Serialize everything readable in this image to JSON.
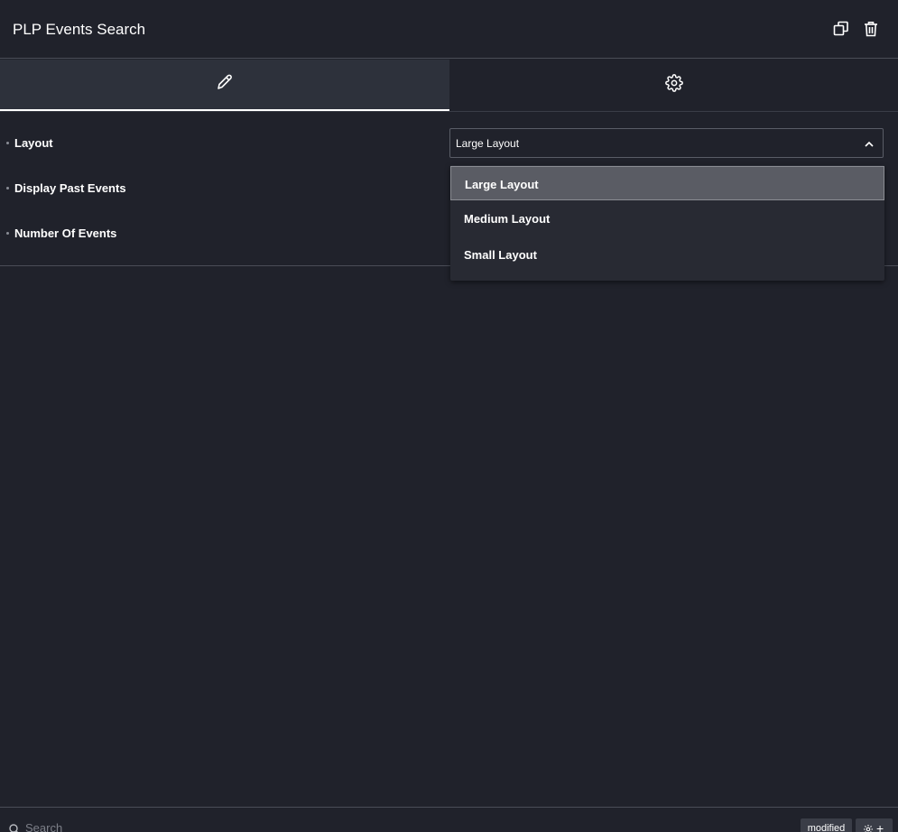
{
  "header": {
    "title": "PLP Events Search",
    "copy_icon": "copy-icon",
    "delete_icon": "trash-icon"
  },
  "tabs": [
    {
      "icon": "pencil-icon",
      "active": true
    },
    {
      "icon": "gear-icon",
      "active": false
    }
  ],
  "controls": {
    "layout_label": "Layout",
    "past_events_label": "Display Past Events",
    "number_events_label": "Number Of Events"
  },
  "layout_select": {
    "value": "Large Layout",
    "options": [
      "Large Layout",
      "Medium Layout",
      "Small Layout"
    ],
    "selected_index": 0
  },
  "footer": {
    "search_placeholder": "Search",
    "badge": "modified"
  },
  "colors": {
    "background": "#20222b",
    "active_tab": "#2d313b",
    "selected_option": "#5a5c64",
    "text": "#ffffff"
  }
}
